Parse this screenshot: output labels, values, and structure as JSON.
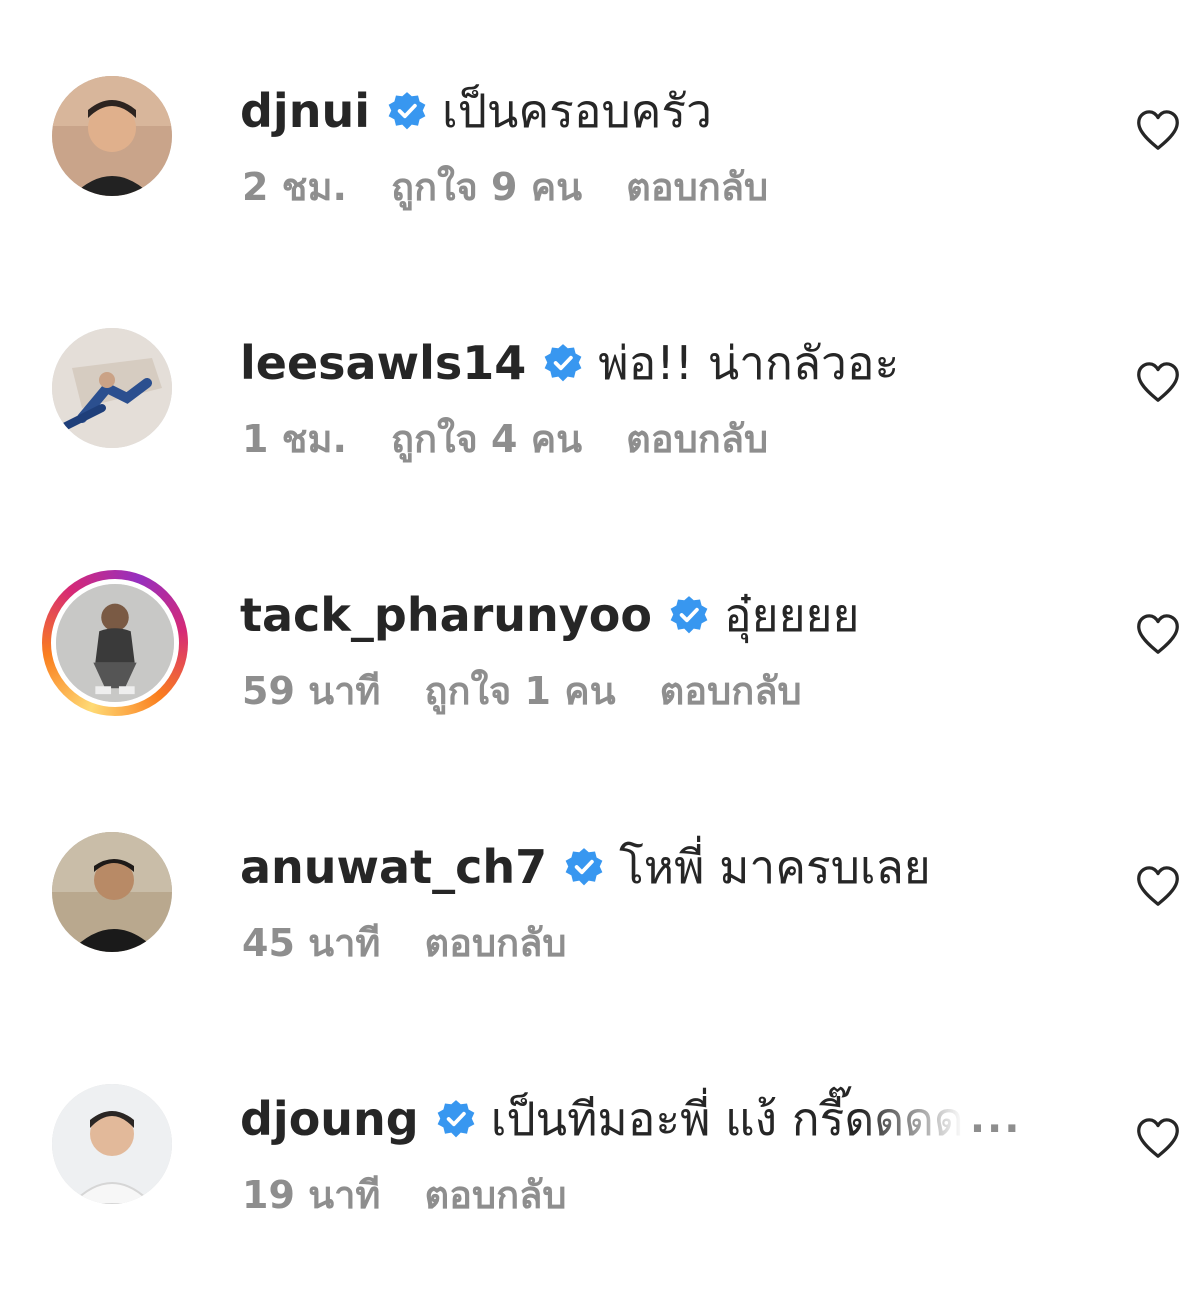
{
  "comments": [
    {
      "username": "djnui",
      "text": "เป็นครอบครัว",
      "time": "2 ชม.",
      "likes": "ถูกใจ 9 คน",
      "reply": "ตอบกลับ",
      "avatar_icon": "profile-photo",
      "story_ring": false
    },
    {
      "username": "leesawls14",
      "text": "พ่อ!! น่ากลัวอะ",
      "time": "1 ชม.",
      "likes": "ถูกใจ 4 คน",
      "reply": "ตอบกลับ",
      "avatar_icon": "profile-photo",
      "story_ring": false
    },
    {
      "username": "tack_pharunyoo",
      "text": "อุ๋ยยยย",
      "time": "59 นาที",
      "likes": "ถูกใจ 1 คน",
      "reply": "ตอบกลับ",
      "avatar_icon": "profile-photo",
      "story_ring": true
    },
    {
      "username": "anuwat_ch7",
      "text": "โหพี่ มาครบเลย",
      "time": "45 นาที",
      "likes": "",
      "reply": "ตอบกลับ",
      "avatar_icon": "profile-photo",
      "story_ring": false
    },
    {
      "username": "djoung",
      "text": "เป็นทีมอะพี่ แง้ กรี๊ดดดด",
      "more": "...",
      "time": "19 นาที",
      "likes": "",
      "reply": "ตอบกลับ",
      "avatar_icon": "profile-photo",
      "story_ring": false
    }
  ],
  "icons": {
    "verified": "verified-badge-icon",
    "like": "heart-outline-icon"
  },
  "colors": {
    "verified_blue": "#3897f0",
    "primary_text": "#262626",
    "secondary_text": "#8e8e8e"
  }
}
